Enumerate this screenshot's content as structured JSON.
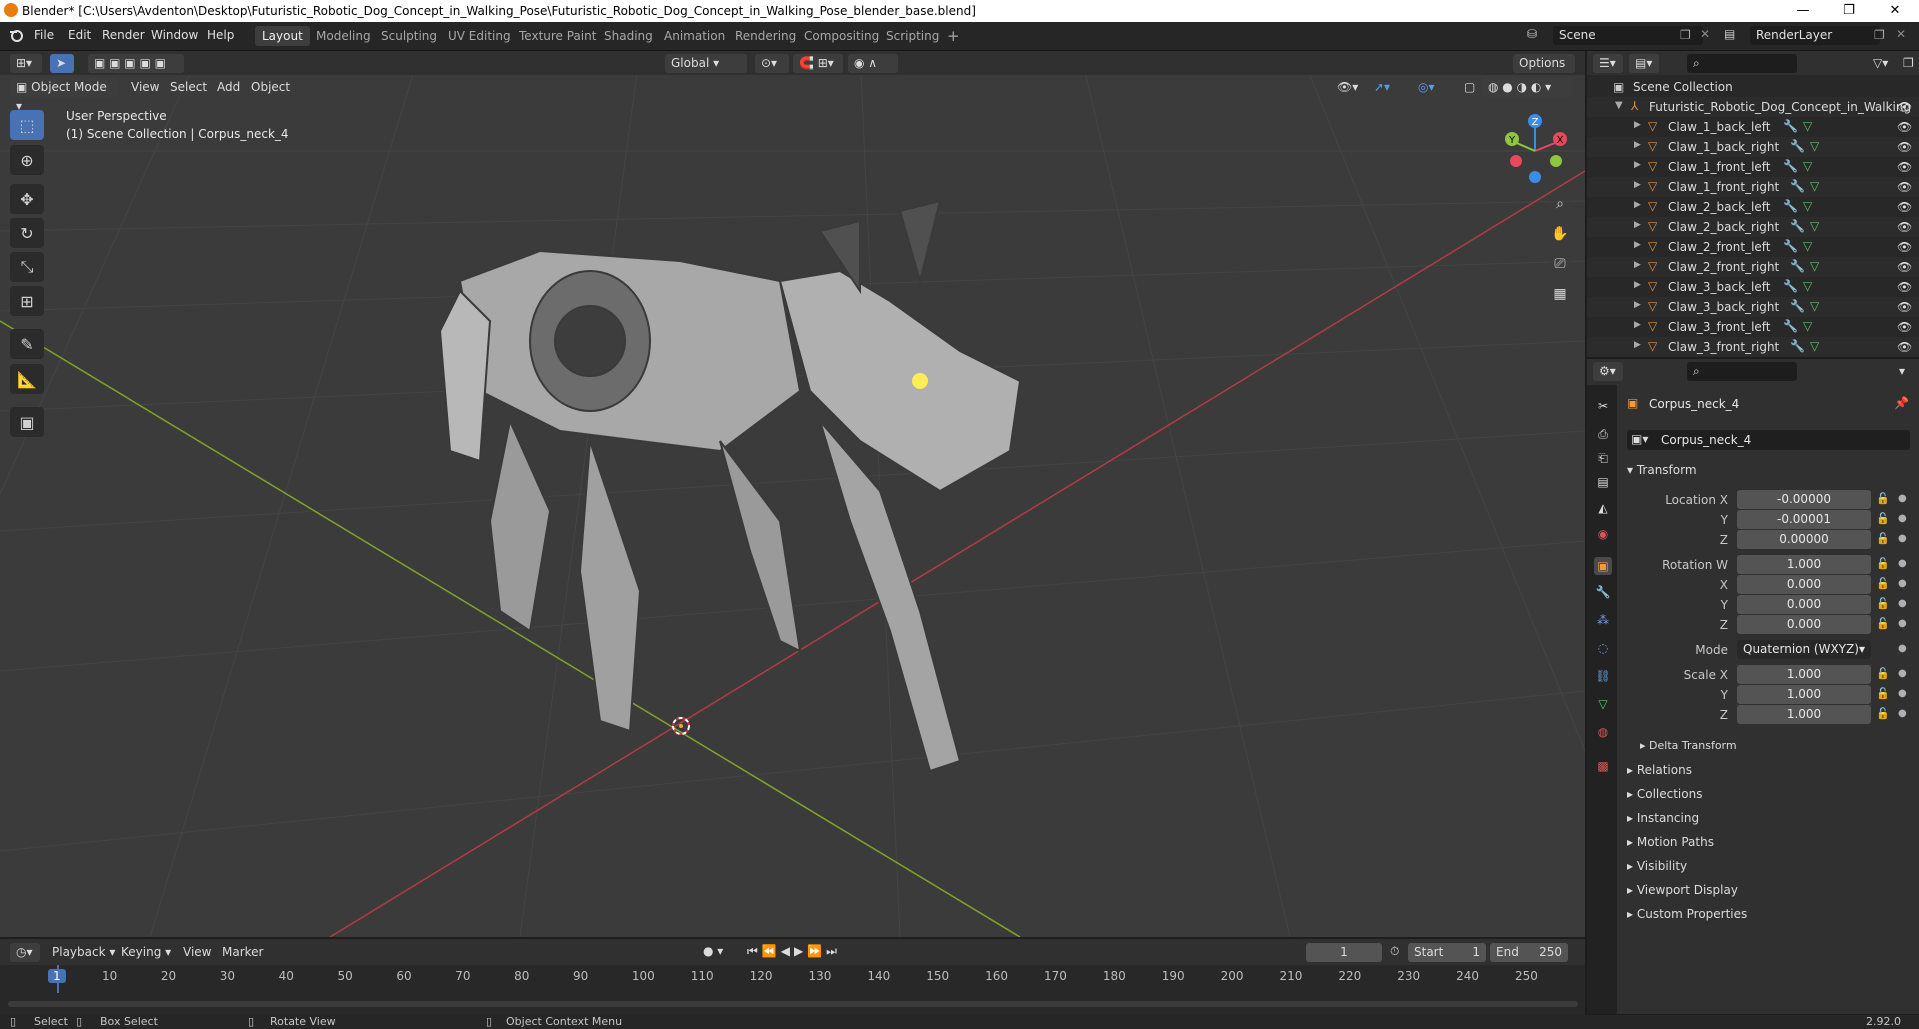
{
  "titlebar": {
    "title": "Blender* [C:\\Users\\Avdenton\\Desktop\\Futuristic_Robotic_Dog_Concept_in_Walking_Pose\\Futuristic_Robotic_Dog_Concept_in_Walking_Pose_blender_base.blend]",
    "minimize": "—",
    "maximize": "❐",
    "close": "✕"
  },
  "menu": {
    "file": "File",
    "edit": "Edit",
    "render": "Render",
    "window": "Window",
    "help": "Help"
  },
  "workspaces": [
    "Layout",
    "Modeling",
    "Sculpting",
    "UV Editing",
    "Texture Paint",
    "Shading",
    "Animation",
    "Rendering",
    "Compositing",
    "Scripting"
  ],
  "active_workspace": "Layout",
  "scene": {
    "name": "Scene",
    "view_layer": "RenderLayer"
  },
  "viewport": {
    "mode": "Object Mode",
    "menus": [
      "View",
      "Select",
      "Add",
      "Object"
    ],
    "orientation": "Global",
    "options": "Options",
    "overlay_title": "User Perspective",
    "overlay_subtitle": "(1) Scene Collection | Corpus_neck_4",
    "gizmo": {
      "z": "Z",
      "y": "Y",
      "x": "X"
    }
  },
  "outliner": {
    "root": "Scene Collection",
    "collection": "Futuristic_Robotic_Dog_Concept_in_Walking",
    "items": [
      "Claw_1_back_left",
      "Claw_1_back_right",
      "Claw_1_front_left",
      "Claw_1_front_right",
      "Claw_2_back_left",
      "Claw_2_back_right",
      "Claw_2_front_left",
      "Claw_2_front_right",
      "Claw_3_back_left",
      "Claw_3_back_right",
      "Claw_3_front_left",
      "Claw_3_front_right"
    ]
  },
  "properties": {
    "object_name": "Corpus_neck_4",
    "data_name": "Corpus_neck_4",
    "transform_label": "Transform",
    "location_label": "Location X",
    "location": {
      "x": "-0.00000",
      "y": "-0.00001",
      "z": "0.00000"
    },
    "rotation_label": "Rotation W",
    "rotation": {
      "w": "1.000",
      "x": "0.000",
      "y": "0.000",
      "z": "0.000"
    },
    "mode_label": "Mode",
    "mode_value": "Quaternion (WXYZ)",
    "scale_label": "Scale X",
    "scale": {
      "x": "1.000",
      "y": "1.000",
      "z": "1.000"
    },
    "axis_labels": {
      "x": "X",
      "y": "Y",
      "z": "Z"
    },
    "delta_transform": "Delta Transform",
    "panels": [
      "Relations",
      "Collections",
      "Instancing",
      "Motion Paths",
      "Visibility",
      "Viewport Display",
      "Custom Properties"
    ]
  },
  "timeline": {
    "menus": [
      "Playback",
      "Keying",
      "View",
      "Marker"
    ],
    "current_frame": "1",
    "start_label": "Start",
    "start": "1",
    "end_label": "End",
    "end": "250",
    "ticks": [
      "1",
      "10",
      "20",
      "30",
      "40",
      "50",
      "60",
      "70",
      "80",
      "90",
      "100",
      "110",
      "120",
      "130",
      "140",
      "150",
      "160",
      "170",
      "180",
      "190",
      "200",
      "210",
      "220",
      "230",
      "240",
      "250"
    ]
  },
  "status": {
    "select": "Select",
    "box_select": "Box Select",
    "rotate_view": "Rotate View",
    "context_menu": "Object Context Menu",
    "version": "2.92.0"
  },
  "colors": {
    "accent": "#4772b3",
    "x_axis": "#e7495b",
    "y_axis": "#8dc73f",
    "z_axis": "#3b8ce6",
    "mesh_icon": "#e08a3b"
  }
}
